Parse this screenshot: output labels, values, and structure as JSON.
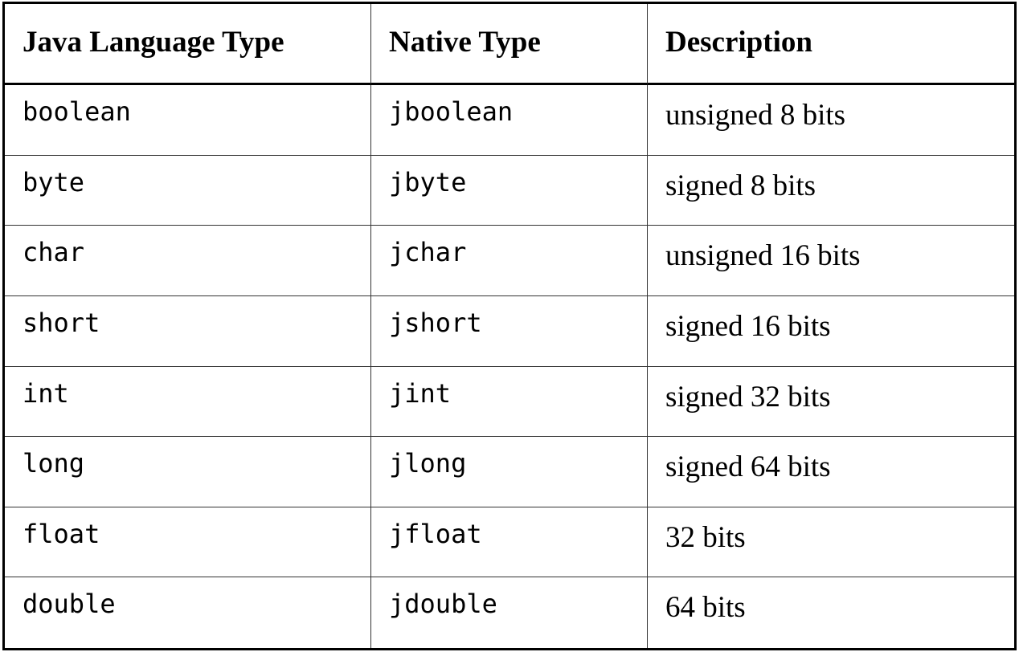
{
  "table": {
    "headers": [
      "Java Language Type",
      "Native Type",
      "Description"
    ],
    "rows": [
      {
        "java": "boolean",
        "native": "jboolean",
        "description": "unsigned 8 bits"
      },
      {
        "java": "byte",
        "native": "jbyte",
        "description": "signed 8 bits"
      },
      {
        "java": "char",
        "native": "jchar",
        "description": "unsigned 16 bits"
      },
      {
        "java": "short",
        "native": "jshort",
        "description": "signed 16 bits"
      },
      {
        "java": "int",
        "native": "jint",
        "description": "signed 32 bits"
      },
      {
        "java": "long",
        "native": "jlong",
        "description": "signed 64 bits"
      },
      {
        "java": "float",
        "native": "jfloat",
        "description": "32 bits"
      },
      {
        "java": "double",
        "native": "jdouble",
        "description": "64 bits"
      }
    ]
  }
}
